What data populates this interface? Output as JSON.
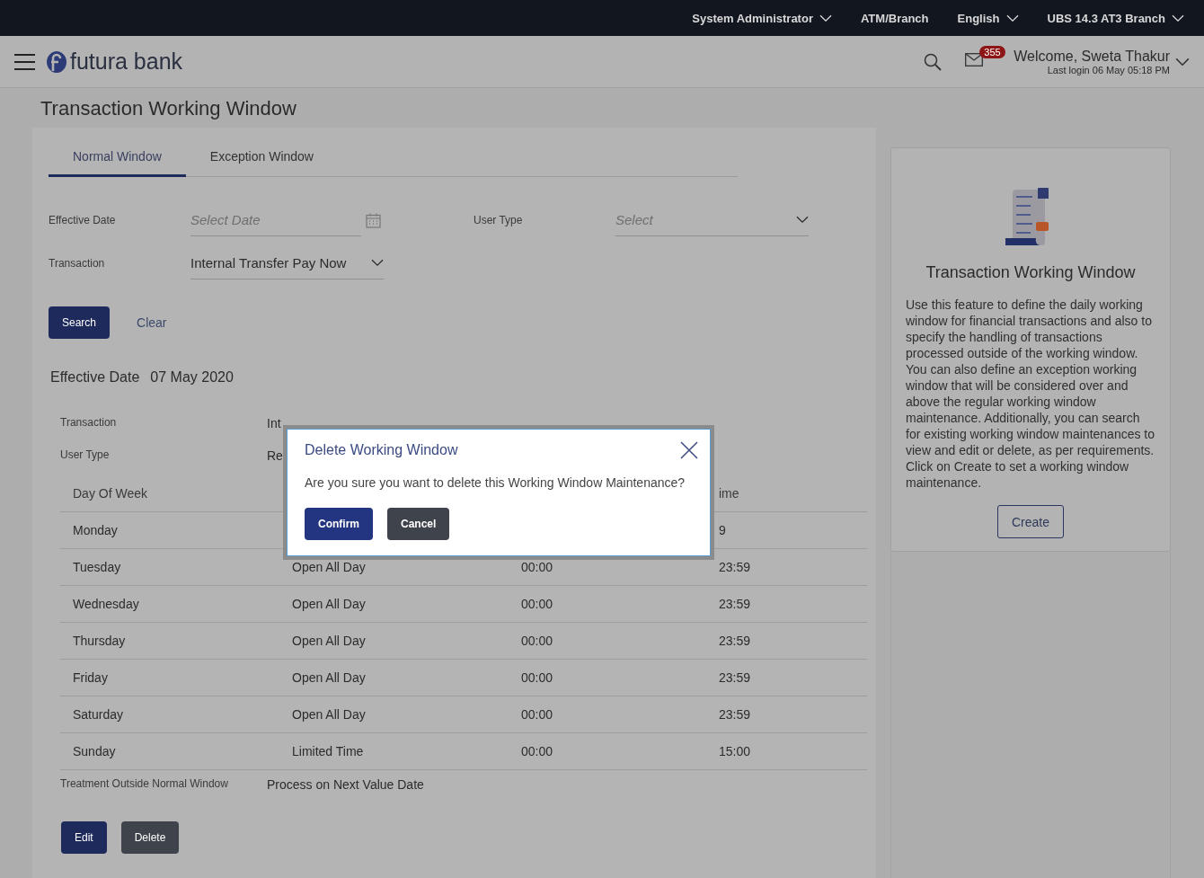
{
  "top_bar": {
    "items": [
      {
        "label": "System Administrator",
        "has_caret": true
      },
      {
        "label": "ATM/Branch",
        "has_caret": false
      },
      {
        "label": "English",
        "has_caret": true
      },
      {
        "label": "UBS 14.3 AT3 Branch",
        "has_caret": true
      }
    ]
  },
  "header": {
    "logo_text": "futura bank",
    "notification_count": "355",
    "welcome": "Welcome, Sweta Thakur",
    "last_login": "Last login 06 May 05:18 PM"
  },
  "page_title": "Transaction Working Window",
  "tabs": [
    {
      "label": "Normal Window",
      "selected": true
    },
    {
      "label": "Exception Window",
      "selected": false
    }
  ],
  "form": {
    "effective_date": {
      "label": "Effective Date",
      "placeholder": "Select Date"
    },
    "user_type": {
      "label": "User Type",
      "placeholder": "Select"
    },
    "transaction": {
      "label": "Transaction",
      "value": "Internal Transfer Pay Now"
    }
  },
  "form_buttons": {
    "search": "Search",
    "clear": "Clear"
  },
  "summary": {
    "label": "Effective Date",
    "value": "07 May 2020"
  },
  "details": [
    {
      "label": "Transaction",
      "value": "Int"
    },
    {
      "label": "User Type",
      "value": "Re"
    }
  ],
  "table": {
    "columns": {
      "day": "Day Of Week",
      "end": "ime"
    },
    "rows": [
      {
        "day": "Monday",
        "end": "9"
      },
      {
        "day": "Tuesday",
        "status": "Open All Day",
        "start": "00:00",
        "end": "23:59"
      },
      {
        "day": "Wednesday",
        "status": "Open All Day",
        "start": "00:00",
        "end": "23:59"
      },
      {
        "day": "Thursday",
        "status": "Open All Day",
        "start": "00:00",
        "end": "23:59"
      },
      {
        "day": "Friday",
        "status": "Open All Day",
        "start": "00:00",
        "end": "23:59"
      },
      {
        "day": "Saturday",
        "status": "Open All Day",
        "start": "00:00",
        "end": "23:59"
      },
      {
        "day": "Sunday",
        "status": "Limited Time",
        "start": "00:00",
        "end": "15:00"
      }
    ]
  },
  "treatment": {
    "label": "Treatment Outside Normal Window",
    "value": "Process on Next Value Date"
  },
  "actions": [
    "Edit",
    "Delete"
  ],
  "help": {
    "title": "Transaction Working Window",
    "text": "Use this feature to define the daily working window for financial transactions and also to specify the handling of transactions processed outside of the working window. You can also define an exception working window that will be considered over and above the regular working window maintenance. Additionally, you can search for existing working window maintenances to view and edit or delete, as per requirements. Click on Create to set a working window maintenance.",
    "button": "Create"
  },
  "dialog": {
    "title": "Delete Working Window",
    "message": "Are you sure you want to delete this Working Window Maintenance?",
    "buttons": [
      {
        "label": "Confirm",
        "kind": "primary"
      },
      {
        "label": "Cancel",
        "kind": "secondary"
      }
    ]
  }
}
